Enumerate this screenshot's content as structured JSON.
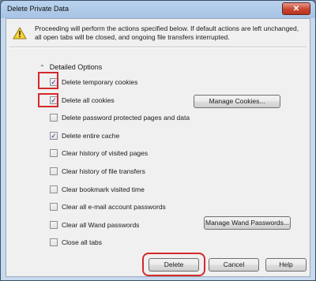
{
  "window": {
    "title": "Delete Private Data",
    "close_label": "✕"
  },
  "message": "Proceeding will perform the actions specified below. If default actions are left unchanged, all open tabs will be closed, and ongoing file transfers interrupted.",
  "details_toggle": {
    "icon": "chevron-up-icon",
    "label": "Detailed Options"
  },
  "options": [
    {
      "label": "Delete temporary cookies",
      "checked": true
    },
    {
      "label": "Delete all cookies",
      "checked": true
    },
    {
      "label": "Delete password protected pages and data",
      "checked": false
    },
    {
      "label": "Delete entire cache",
      "checked": true
    },
    {
      "label": "Clear history of visited pages",
      "checked": false
    },
    {
      "label": "Clear history of file transfers",
      "checked": false
    },
    {
      "label": "Clear bookmark visited time",
      "checked": false
    },
    {
      "label": "Clear all e-mail account passwords",
      "checked": false
    },
    {
      "label": "Clear all Wand passwords",
      "checked": false
    },
    {
      "label": "Close all tabs",
      "checked": false
    }
  ],
  "buttons": {
    "manage_cookies": "Manage Cookies...",
    "manage_wand": "Manage Wand Passwords...",
    "delete": "Delete",
    "cancel": "Cancel",
    "help": "Help"
  },
  "colors": {
    "highlight": "#d42a2a",
    "dialog_bg": "#f0f0f0",
    "close_button": "#c8452f"
  }
}
